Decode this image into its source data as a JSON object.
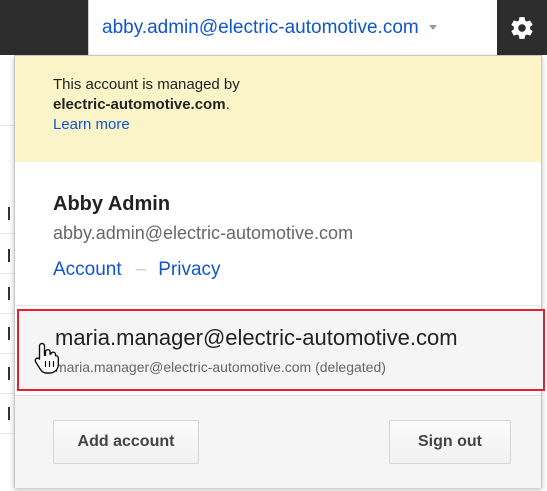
{
  "topbar": {
    "account_email": "abby.admin@electric-automotive.com",
    "caret_icon": "chevron-down-icon",
    "settings_icon": "gear-icon"
  },
  "managed_notice": {
    "line1": "This account is managed by",
    "domain": "electric-automotive.com",
    "period": ".",
    "learn_more": "Learn more"
  },
  "profile": {
    "name": "Abby Admin",
    "email": "abby.admin@electric-automotive.com",
    "links": {
      "account": "Account",
      "separator": "–",
      "privacy": "Privacy"
    }
  },
  "delegated_account": {
    "primary": "maria.manager@electric-automotive.com",
    "secondary": "maria.manager@electric-automotive.com (delegated)"
  },
  "footer": {
    "add_account": "Add account",
    "sign_out": "Sign out"
  },
  "colors": {
    "link": "#1155cc",
    "notice_bg": "#fbf4c9",
    "highlight_border": "#e8202a",
    "topbar_dark": "#2d2d2d"
  }
}
